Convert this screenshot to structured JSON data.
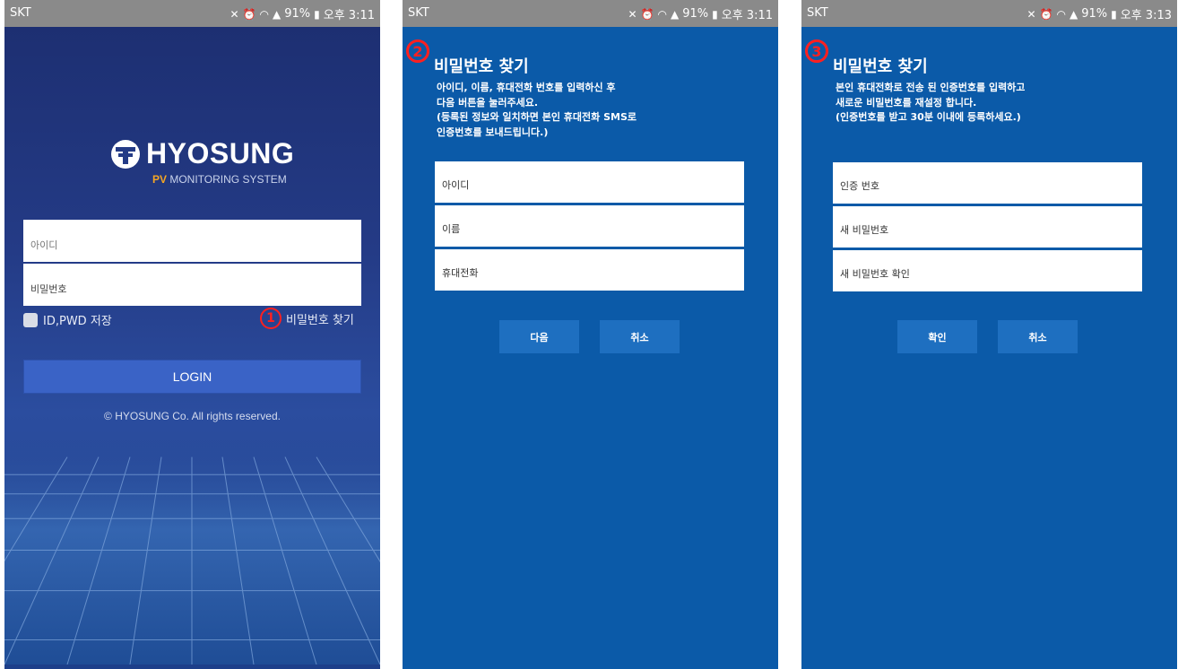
{
  "screen1": {
    "status": {
      "carrier": "SKT",
      "battery": "91%",
      "time": "오후 3:11"
    },
    "logo": {
      "name": "HYOSUNG",
      "sub_prefix": "PV",
      "sub_rest": " MONITORING SYSTEM"
    },
    "id_placeholder": "아이디",
    "pw_placeholder": "비밀번호",
    "save_label": "ID,PWD 저장",
    "step_number": "1",
    "find_link": "비밀번호 찾기",
    "login_button": "LOGIN",
    "copyright": "© HYOSUNG Co. All rights reserved."
  },
  "screen2": {
    "status": {
      "carrier": "SKT",
      "battery": "91%",
      "time": "오후 3:11"
    },
    "step_number": "2",
    "title": "비밀번호 찾기",
    "desc": [
      "아이디, 이름, 휴대전화 번호를 입력하신 후",
      "다음 버튼을 눌러주세요.",
      "(등록된 정보와 일치하면 본인 휴대전화 SMS로",
      "인증번호를 보내드립니다.)"
    ],
    "fields": [
      "아이디",
      "이름",
      "휴대전화"
    ],
    "next_button": "다음",
    "cancel_button": "취소"
  },
  "screen3": {
    "status": {
      "carrier": "SKT",
      "battery": "91%",
      "time": "오후 3:13"
    },
    "step_number": "3",
    "title": "비밀번호 찾기",
    "desc": [
      "본인 휴대전화로 전송 된 인증번호를 입력하고",
      "새로운 비밀번호를 재설정 합니다.",
      "(인증번호를 받고 30분 이내에 등록하세요.)"
    ],
    "fields": [
      "인증 번호",
      "새 비밀번호",
      "새 비밀번호 확인"
    ],
    "confirm_button": "확인",
    "cancel_button": "취소"
  },
  "colors": {
    "login_bg": "#243b86",
    "form_bg": "#0b5aa8",
    "button": "#1e6fc0",
    "login_button": "#3a63c6",
    "status_bar": "#8a8a8a",
    "step_marker": "#ff2020",
    "logo_accent": "#f5a623"
  },
  "icons": [
    "vibrate-icon",
    "alarm-icon",
    "wifi-icon",
    "signal-icon",
    "battery-icon",
    "hyosung-logo-icon"
  ]
}
